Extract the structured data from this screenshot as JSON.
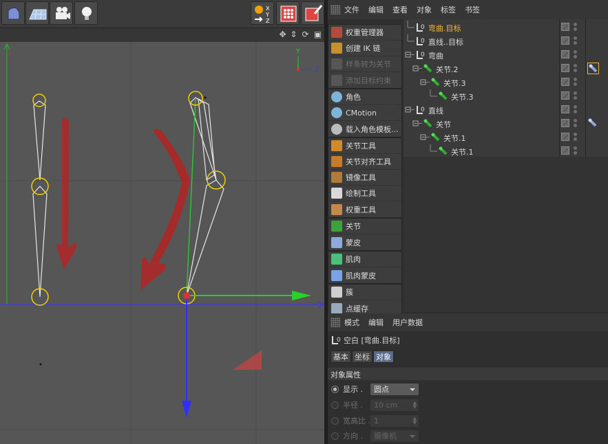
{
  "object_manager": {
    "menu": [
      "文件",
      "编辑",
      "查看",
      "对象",
      "标签",
      "书签"
    ],
    "objects": [
      {
        "name": "弯曲.目标",
        "active": true
      },
      {
        "name": "直线..目标",
        "active": false
      },
      {
        "name": "弯曲",
        "active": false
      },
      {
        "name": "关节.2",
        "active": false
      },
      {
        "name": "关节.3",
        "active": false
      },
      {
        "name": "关节.3",
        "active": false
      },
      {
        "name": "直线",
        "active": false
      },
      {
        "name": "关节",
        "active": false
      },
      {
        "name": "关节.1",
        "active": false
      },
      {
        "name": "关节.1",
        "active": false
      }
    ]
  },
  "character_tools": {
    "group1": [
      "权重管理器",
      "创建 IK 链",
      "样条转为关节",
      "添加目标约束"
    ],
    "group2": [
      "角色",
      "CMotion",
      "载入角色模板..."
    ],
    "group3": [
      "关节工具",
      "关节对齐工具",
      "镜像工具",
      "绘制工具",
      "权重工具"
    ],
    "group4": [
      "关节",
      "蒙皮"
    ],
    "group5": [
      "肌肉",
      "肌肉蒙皮"
    ],
    "group6": [
      "簇",
      "点缓存"
    ]
  },
  "viewport": {
    "axis_y": "Y",
    "axis_z": "Z",
    "coord_x": "X",
    "coord_y": "Y",
    "coord_z": "Z"
  },
  "attributes": {
    "menu": [
      "模式",
      "编辑",
      "用户数据"
    ],
    "title": "空白 [弯曲.目标]",
    "tabs": [
      "基本",
      "坐标",
      "对象"
    ],
    "active_tab": "对象",
    "section": "对象属性",
    "display_label": "显示 .",
    "display_value": "圆点",
    "radius_label": "半径 .",
    "radius_value": "10 cm",
    "aspect_label": "宽高比 .",
    "aspect_value": "1",
    "orientation_label": "方向 .",
    "orientation_value": "摄像机"
  },
  "colors": {
    "accent_active": "#f3b53b",
    "tab_active": "#5a6b89",
    "viewport_bg": "#565656",
    "axis_green": "#2bd12b",
    "axis_blue": "#3434ff",
    "annotation_red": "#b32424"
  }
}
